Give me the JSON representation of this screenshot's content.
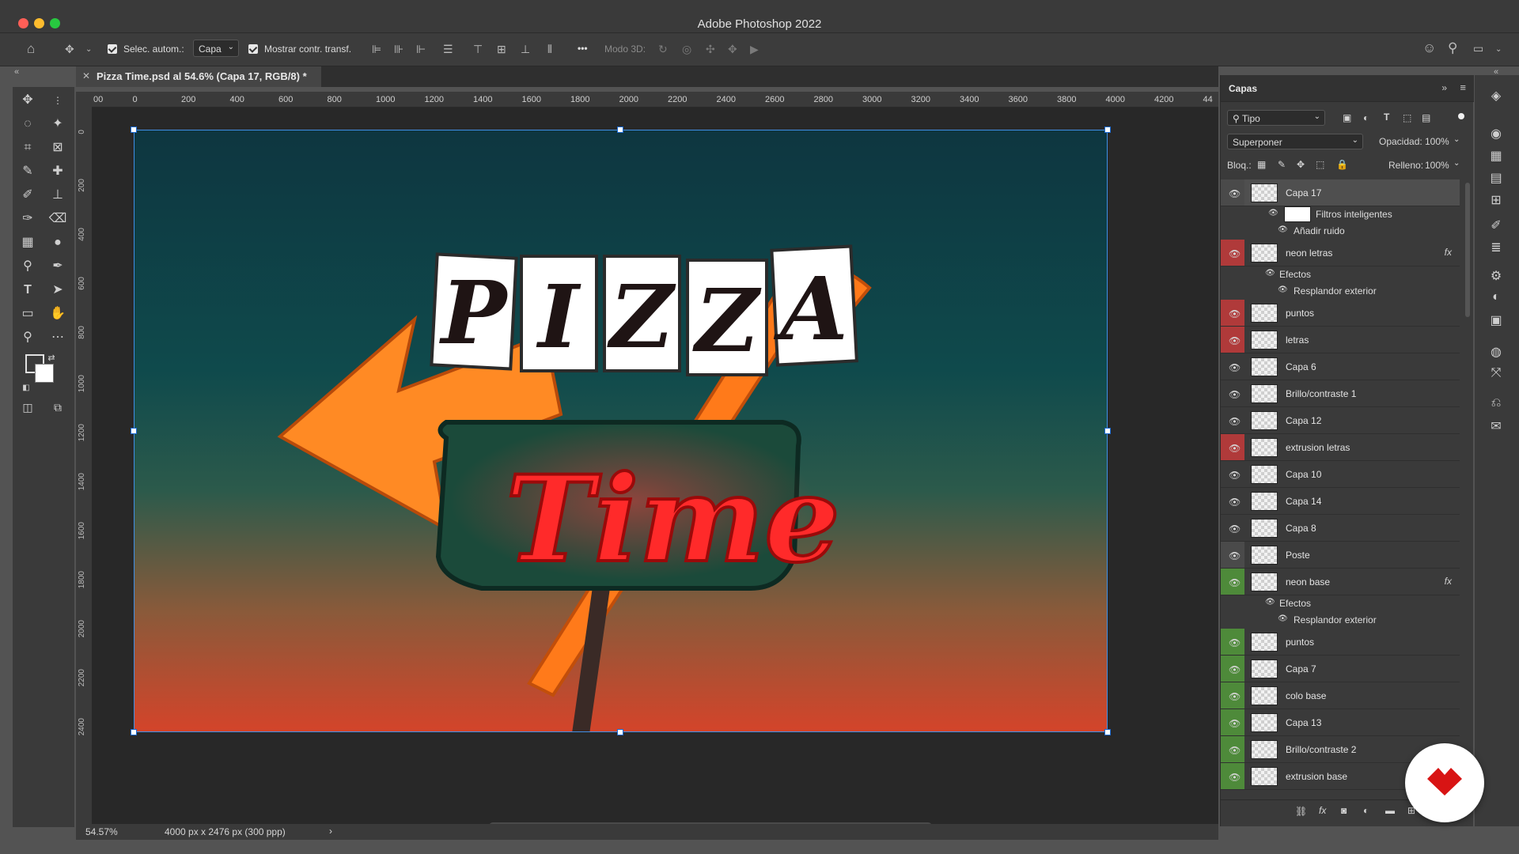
{
  "window": {
    "title": "Adobe Photoshop 2022",
    "controls": {
      "close_color": "#ff5f57",
      "minimize_color": "#febc2e",
      "maximize_color": "#28c840"
    }
  },
  "options_bar": {
    "auto_select_label": "Selec. autom.:",
    "auto_select_value": "Capa",
    "show_transform_label": "Mostrar contr. transf.",
    "more_label": "•••",
    "mode3d_label": "Modo 3D:"
  },
  "document": {
    "tab_title": "Pizza Time.psd al 54.6% (Capa 17, RGB/8) *",
    "ruler_top_ticks": [
      "00",
      "0",
      "200",
      "400",
      "600",
      "800",
      "1000",
      "1200",
      "1400",
      "1600",
      "1800",
      "2000",
      "2200",
      "2400",
      "2600",
      "2800",
      "3000",
      "3200",
      "3400",
      "3600",
      "3800",
      "4000",
      "4200",
      "44"
    ],
    "ruler_left_ticks": [
      "0",
      "2 0 0",
      "4 0 0",
      "6 0 0",
      "8 0 0",
      "1 0 0 0",
      "1 2 0 0",
      "1 4 0 0",
      "1 6 0 0",
      "1 8 0 0",
      "2 0 0 0",
      "2 2 0 0",
      "2 4 0 0"
    ],
    "artwork": {
      "word_top": "PIZZA",
      "word_script": "Time",
      "word_top_letters": [
        "P",
        "I",
        "Z",
        "Z",
        "A"
      ]
    }
  },
  "status_bar": {
    "zoom": "54.57%",
    "doc_info": "4000 px x 2476 px (300 ppp)",
    "arrow": "›"
  },
  "layers_panel": {
    "title": "Capas",
    "filter_type": "Tipo",
    "blend_mode": "Superponer",
    "opacity_label": "Opacidad:",
    "opacity_value": "100%",
    "lock_label": "Bloq.:",
    "fill_label": "Relleno:",
    "fill_value": "100%",
    "layers": [
      {
        "name": "Capa 17",
        "eye": "👁",
        "color": "#4a4a4a",
        "selected": true
      },
      {
        "name": "Filtros inteligentes",
        "sub": true
      },
      {
        "name": "Añadir ruido",
        "sub": true
      },
      {
        "name": "neon letras",
        "eye": "👁",
        "color": "#b03a3a",
        "fx": "fx"
      },
      {
        "name": "Efectos",
        "sub": true
      },
      {
        "name": "Resplandor exterior",
        "sub": true
      },
      {
        "name": "puntos",
        "eye": "👁",
        "color": "#b03a3a"
      },
      {
        "name": "letras",
        "eye": "👁",
        "color": "#b03a3a"
      },
      {
        "name": "Capa 6",
        "eye": "👁"
      },
      {
        "name": "Brillo/contraste 1",
        "eye": "👁"
      },
      {
        "name": "Capa 12",
        "eye": "👁"
      },
      {
        "name": "extrusion letras",
        "eye": "👁",
        "color": "#b03a3a"
      },
      {
        "name": "Capa 10",
        "eye": "👁"
      },
      {
        "name": "Capa 14",
        "eye": "👁"
      },
      {
        "name": "Capa 8",
        "eye": "👁"
      },
      {
        "name": "Poste",
        "eye": "👁",
        "color": "#4a4a4a"
      },
      {
        "name": "neon base",
        "eye": "👁",
        "color": "#4e8a3a",
        "fx": "fx"
      },
      {
        "name": "Efectos",
        "sub": true
      },
      {
        "name": "Resplandor exterior",
        "sub": true
      },
      {
        "name": "puntos",
        "eye": "👁",
        "color": "#4e8a3a"
      },
      {
        "name": "Capa 7",
        "eye": "👁",
        "color": "#4e8a3a"
      },
      {
        "name": "colo base",
        "eye": "👁",
        "color": "#4e8a3a"
      },
      {
        "name": "Capa 13",
        "eye": "👁",
        "color": "#4e8a3a"
      },
      {
        "name": "Brillo/contraste 2",
        "eye": "👁",
        "color": "#4e8a3a"
      },
      {
        "name": "extrusion base",
        "eye": "👁",
        "color": "#4e8a3a"
      }
    ],
    "footer_icons": [
      "link-icon",
      "fx-icon",
      "mask-icon",
      "adjustment-icon",
      "folder-icon",
      "new-layer-icon",
      "trash-icon"
    ]
  }
}
